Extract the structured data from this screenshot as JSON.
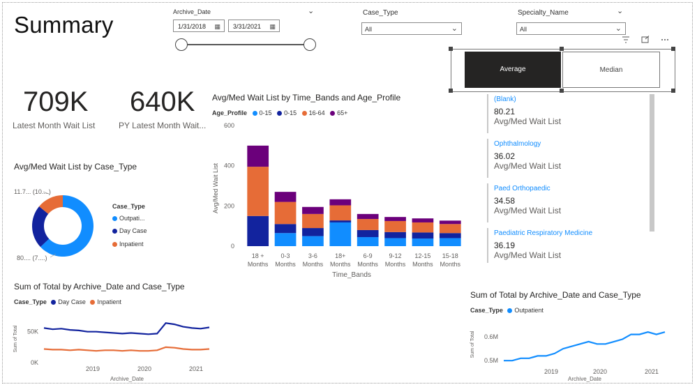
{
  "page": {
    "title": "Summary"
  },
  "archive_date": {
    "label": "Archive_Date",
    "start": "1/31/2018",
    "end": "3/31/2021"
  },
  "case_type_slicer": {
    "label": "Case_Type",
    "value": "All"
  },
  "specialty_slicer": {
    "label": "Specialty_Name",
    "value": "All"
  },
  "toggle": {
    "average": "Average",
    "median": "Median",
    "selected": "Average"
  },
  "kpis": [
    {
      "value": "709K",
      "label": "Latest Month Wait List"
    },
    {
      "value": "640K",
      "label": "PY Latest Month Wait..."
    }
  ],
  "donut": {
    "title": "Avg/Med Wait List by Case_Type",
    "legend_title": "Case_Type",
    "label_top": "11.7... (10....)",
    "label_bottom": "80.... (7....)",
    "colors": [
      "#118dff",
      "#12239e",
      "#e66c37"
    ],
    "chart_data": {
      "type": "pie",
      "categories": [
        "Outpati...",
        "Day Case",
        "Inpatient"
      ],
      "values": [
        63,
        23,
        14
      ]
    }
  },
  "bar": {
    "title": "Avg/Med Wait List by Time_Bands and Age_Profile",
    "legend_title": "Age_Profile",
    "chart_data": {
      "type": "bar",
      "stacked": true,
      "categories": [
        "18 + Months",
        "0-3 Months",
        "3-6 Months",
        "18+ Months",
        "6-9 Months",
        "9-12 Months",
        "12-15 Months",
        "15-18 Months"
      ],
      "series": [
        {
          "name": "0-15",
          "color": "#118dff",
          "values": [
            0,
            65,
            50,
            118,
            45,
            40,
            38,
            40
          ]
        },
        {
          "name": "0-15",
          "color": "#12239e",
          "values": [
            150,
            45,
            40,
            10,
            35,
            30,
            30,
            25
          ]
        },
        {
          "name": "16-64",
          "color": "#e66c37",
          "values": [
            245,
            110,
            70,
            75,
            55,
            55,
            50,
            45
          ]
        },
        {
          "name": "65+",
          "color": "#6b007b",
          "values": [
            105,
            50,
            35,
            30,
            25,
            20,
            20,
            17
          ]
        }
      ],
      "xlabel": "Time_Bands",
      "ylabel": "Avg/Med Wait List",
      "ylim": [
        0,
        600
      ],
      "yticks": [
        "0",
        "200",
        "400",
        "600"
      ]
    }
  },
  "cards": [
    {
      "name": "(Blank)",
      "value": "80.21",
      "label": "Avg/Med Wait List"
    },
    {
      "name": "Ophthalmology",
      "value": "36.02",
      "label": "Avg/Med Wait List"
    },
    {
      "name": "Paed Orthopaedic",
      "value": "34.58",
      "label": "Avg/Med Wait List"
    },
    {
      "name": "Paediatric Respiratory Medicine",
      "value": "36.19",
      "label": "Avg/Med Wait List"
    }
  ],
  "line_left": {
    "title": "Sum of Total by Archive_Date and Case_Type",
    "legend_title": "Case_Type",
    "chart_data": {
      "type": "line",
      "x": [
        "2018-02",
        "2018-04",
        "2018-06",
        "2018-08",
        "2018-10",
        "2018-12",
        "2019-02",
        "2019-04",
        "2019-06",
        "2019-08",
        "2019-10",
        "2019-12",
        "2020-02",
        "2020-04",
        "2020-06",
        "2020-08",
        "2020-10",
        "2020-12",
        "2021-02",
        "2021-03"
      ],
      "series": [
        {
          "name": "Day Case",
          "color": "#12239e",
          "values": [
            56,
            54,
            55,
            53,
            52,
            50,
            50,
            49,
            48,
            47,
            48,
            47,
            46,
            47,
            64,
            62,
            58,
            56,
            55,
            57
          ]
        },
        {
          "name": "Inpatient",
          "color": "#e66c37",
          "values": [
            22,
            21,
            21,
            20,
            21,
            20,
            19,
            20,
            20,
            19,
            20,
            19,
            19,
            20,
            25,
            24,
            22,
            21,
            21,
            22
          ]
        }
      ],
      "xticks": [
        "2019",
        "2020",
        "2021"
      ],
      "yticks": [
        "0K",
        "50K"
      ],
      "xlabel": "Archive_Date",
      "ylabel": "Sum of Total",
      "ylim": [
        0,
        70
      ]
    }
  },
  "line_right": {
    "title": "Sum of Total by Archive_Date and Case_Type",
    "legend_title": "Case_Type",
    "chart_data": {
      "type": "line",
      "x": [
        "2018-02",
        "2018-04",
        "2018-06",
        "2018-08",
        "2018-10",
        "2018-12",
        "2019-02",
        "2019-04",
        "2019-06",
        "2019-08",
        "2019-10",
        "2019-12",
        "2020-02",
        "2020-04",
        "2020-06",
        "2020-08",
        "2020-10",
        "2020-12",
        "2021-02",
        "2021-03"
      ],
      "series": [
        {
          "name": "Outpatient",
          "color": "#118dff",
          "values": [
            0.5,
            0.5,
            0.51,
            0.51,
            0.52,
            0.52,
            0.53,
            0.55,
            0.56,
            0.57,
            0.58,
            0.57,
            0.57,
            0.58,
            0.59,
            0.61,
            0.61,
            0.62,
            0.61,
            0.62
          ]
        }
      ],
      "xticks": [
        "2019",
        "2020",
        "2021"
      ],
      "yticks": [
        "0.5M",
        "0.6M"
      ],
      "xlabel": "Archive_Date",
      "ylabel": "Sum of Total",
      "ylim": [
        0.48,
        0.65
      ]
    }
  },
  "icons": {
    "filter": "filter-icon",
    "focus": "focus-mode-icon",
    "more": "more-options-icon"
  }
}
